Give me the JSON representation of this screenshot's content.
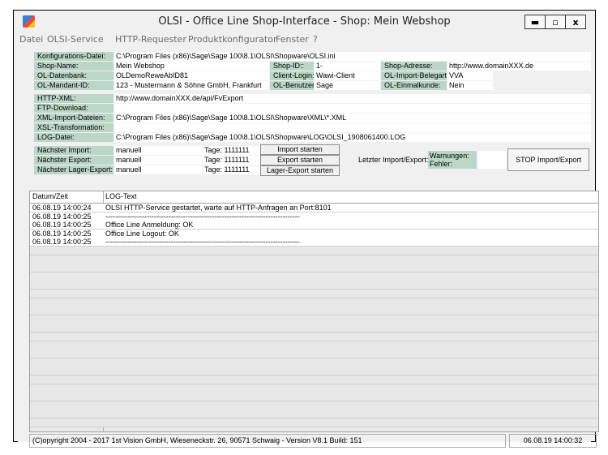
{
  "window": {
    "title": "OLSI - Office Line Shop-Interface - Shop: Mein Webshop",
    "minimize": "▬",
    "maximize": "▫",
    "close": "x"
  },
  "menu": [
    "Datei",
    "OLSI-Service",
    "HTTP-Requester",
    "Produktkonfigurator",
    "Fenster",
    "?"
  ],
  "config": {
    "konfig_label": "Konfigurations-Datei:",
    "konfig_value": "C:\\Program Files (x86)\\Sage\\Sage 100\\8.1\\OLSI\\Shopware\\OLSI.ini",
    "shopname_label": "Shop-Name:",
    "shopname_value": "Mein Webshop",
    "shopid_label": "Shop-ID::",
    "shopid_value": "1-",
    "shopadresse_label": "Shop-Adresse:",
    "shopadresse_value": "http://www.domainXXX.de",
    "datenbank_label": "OL-Datenbank:",
    "datenbank_value": "OLDemoReweAbID81",
    "clientlogin_label": "Client-Login:",
    "clientlogin_value": "Wawi-Client",
    "importbeleg_label": "OL-Import-Belegart:",
    "importbeleg_value": "VVA",
    "mandant_label": "OL-Mandant-ID:",
    "mandant_value": "123 - Mustermann & Söhne GmbH, Frankfurt",
    "benutzer_label": "OL-Benutzer:",
    "benutzer_value": "Sage",
    "einmalkunde_label": "OL-Einmalkunde:",
    "einmalkunde_value": "Nein",
    "httpxml_label": "HTTP-XML:",
    "httpxml_value": "http://www.domainXXX.de/api/FvExport",
    "ftp_label": "FTP-Download:",
    "ftp_value": "",
    "xmlimport_label": "XML-Import-Dateien:",
    "xmlimport_value": "C:\\Program Files (x86)\\Sage\\Sage 100\\8.1\\OLSI\\Shopware\\XML\\*.XML",
    "xsl_label": "XSL-Transformation:",
    "xsl_value": "",
    "log_label": "LOG-Datei:",
    "log_value": "C:\\Program Files (x86)\\Sage\\Sage 100\\8.1\\OLSI\\Shopware\\LOG\\OLSI_1908061400.LOG"
  },
  "schedule": {
    "import_label": "Nächster Import:",
    "import_mode": "manuell",
    "import_tage": "Tage: 1111111",
    "import_button": "Import starten",
    "export_label": "Nächster Export:",
    "export_mode": "manuell",
    "export_tage": "Tage: 1111111",
    "export_button": "Export starten",
    "lager_label": "Nächster Lager-Export:",
    "lager_mode": "manuell",
    "lager_tage": "Tage: 1111111",
    "lager_button": "Lager-Export starten",
    "letzter_label": "Letzter Import/Export:",
    "warnungen_label": "Warnungen:",
    "fehler_label": "Fehler:",
    "stop_button": "STOP Import/Export"
  },
  "log": {
    "col_datum": "Datum/Zeit",
    "col_text": "LOG-Text",
    "rows": [
      {
        "time": "06.08.19 14:00:24",
        "text": "OLSI HTTP-Service gestartet, warte auf HTTP-Anfragen an Port:8101"
      },
      {
        "time": "06.08.19 14:00:25",
        "text": "--------------------------------------------------------------------------------"
      },
      {
        "time": "06.08.19 14:00:25",
        "text": "Office Line Anmeldung: OK"
      },
      {
        "time": "06.08.19 14:00:25",
        "text": "Office Line Logout: OK"
      },
      {
        "time": "06.08.19 14:00:25",
        "text": "--------------------------------------------------------------------------------"
      }
    ]
  },
  "status": {
    "copyright": "(C)opyright 2004 - 2017 1st Vision GmbH, Wieseneckstr. 26, 90571 Schwaig - Version V8.1 Build: 151",
    "time": "06.08.19 14:00:32"
  }
}
